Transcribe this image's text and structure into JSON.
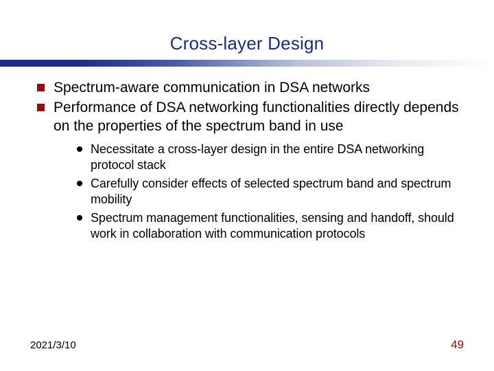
{
  "title": "Cross-layer Design",
  "bullets": {
    "b1": "Spectrum-aware communication in DSA networks",
    "b2": "Performance of DSA networking functionalities directly depends on the properties of the spectrum band in use",
    "sub1": "Necessitate a cross-layer design in the entire DSA networking protocol stack",
    "sub2": "Carefully consider effects of selected spectrum band and spectrum mobility",
    "sub3": "Spectrum management functionalities, sensing and handoff, should work in collaboration with communication protocols"
  },
  "footer": {
    "date": "2021/3/10",
    "page": "49"
  }
}
